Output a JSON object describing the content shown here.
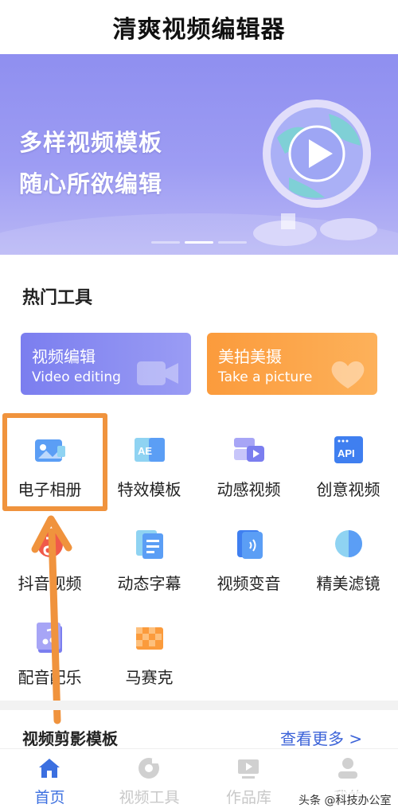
{
  "app": {
    "title": "清爽视频编辑器"
  },
  "banner": {
    "line1": "多样视频模板",
    "line2": "随心所欲编辑",
    "page_indicator": {
      "count": 3,
      "active": 2
    }
  },
  "hot_tools": {
    "title": "热门工具",
    "cards": [
      {
        "cn": "视频编辑",
        "en": "Video editing",
        "icon": "video-camera-icon",
        "color": "#7b7eef"
      },
      {
        "cn": "美拍美摄",
        "en": "Take a picture",
        "icon": "heart-icon",
        "color": "#fb9b3c"
      }
    ],
    "grid": [
      {
        "label": "电子相册",
        "icon": "photo-album-icon"
      },
      {
        "label": "特效模板",
        "icon": "effects-template-icon"
      },
      {
        "label": "动感视频",
        "icon": "dynamic-video-icon"
      },
      {
        "label": "创意视频",
        "icon": "api-icon",
        "icon_text": "API"
      },
      {
        "label": "抖音视频",
        "icon": "douyin-icon"
      },
      {
        "label": "动态字幕",
        "icon": "subtitle-icon"
      },
      {
        "label": "视频变音",
        "icon": "voice-change-icon"
      },
      {
        "label": "精美滤镜",
        "icon": "filter-icon"
      },
      {
        "label": "配音配乐",
        "icon": "music-icon"
      },
      {
        "label": "马赛克",
        "icon": "mosaic-icon"
      }
    ],
    "highlight": {
      "target": "电子相册",
      "color": "#f0933d"
    }
  },
  "section2": {
    "title": "视频剪影模板",
    "more": "查看更多 >"
  },
  "tabbar": {
    "items": [
      {
        "label": "首页",
        "icon": "home-icon",
        "active": true
      },
      {
        "label": "视频工具",
        "icon": "video-tools-icon",
        "active": false
      },
      {
        "label": "作品库",
        "icon": "works-library-icon",
        "active": false
      },
      {
        "label": "我的",
        "icon": "profile-icon",
        "active": false
      }
    ],
    "active_color": "#3b6fe0"
  },
  "watermark": "头条 @科技办公室"
}
